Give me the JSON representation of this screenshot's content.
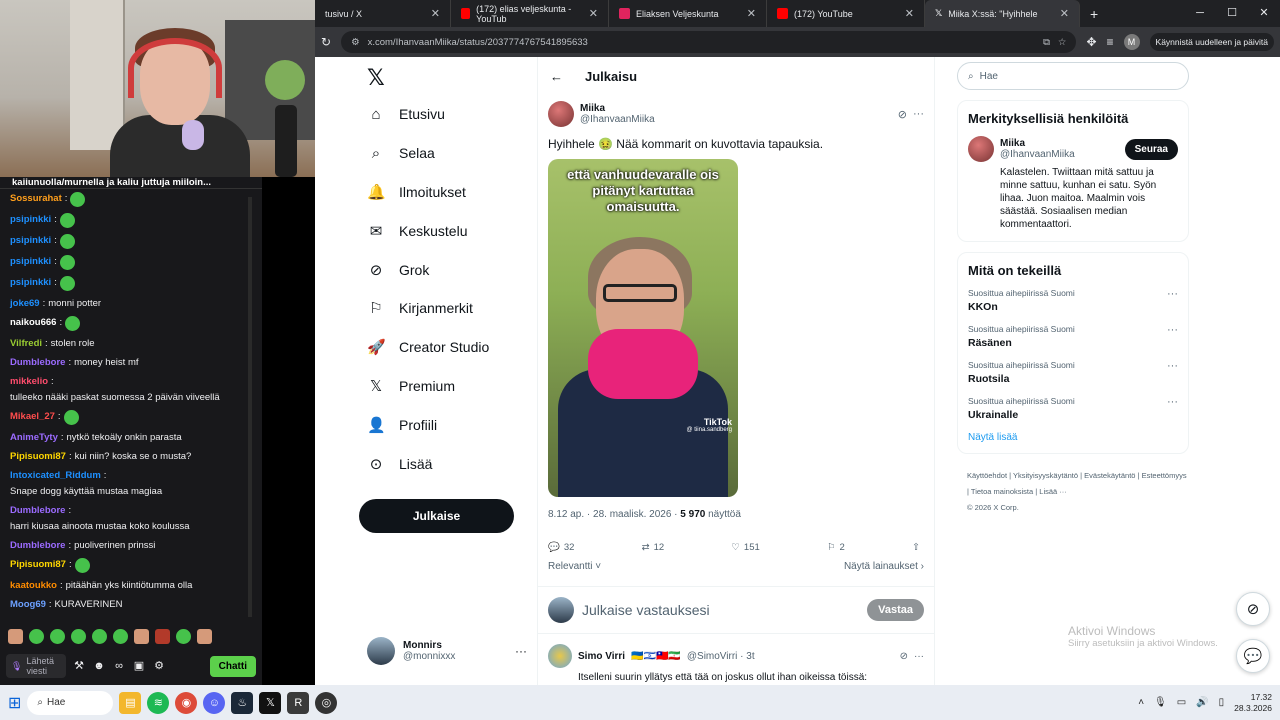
{
  "chat": {
    "pinned_text": "kaiiunuolla/murnella ja kaliu juttuja miiloin...",
    "messages": [
      {
        "user": "Sossurahat",
        "color": "#ff9f1c",
        "text": ""
      },
      {
        "user": "psipinkki",
        "color": "#1e90ff",
        "text": ""
      },
      {
        "user": "psipinkki",
        "color": "#1e90ff",
        "text": ""
      },
      {
        "user": "psipinkki",
        "color": "#1e90ff",
        "text": ""
      },
      {
        "user": "psipinkki",
        "color": "#1e90ff",
        "text": ""
      },
      {
        "user": "joke69",
        "color": "#1e90ff",
        "text": "monni potter"
      },
      {
        "user": "naikou666",
        "color": "#ffffff",
        "text": ""
      },
      {
        "user": "Vilfredi",
        "color": "#9acd32",
        "text": "stolen role"
      },
      {
        "user": "Dumblebore",
        "color": "#9b6bff",
        "text": "money heist mf"
      },
      {
        "user": "mikkelio",
        "color": "#ff4d6d",
        "text": "tulleeko nääki paskat suomessa 2 päivän viiveellä"
      },
      {
        "user": "Mikael_27",
        "color": "#ff4d4d",
        "text": ""
      },
      {
        "user": "AnimeTyty",
        "color": "#9b6bff",
        "text": "nytkö tekoäly onkin parasta"
      },
      {
        "user": "Pipisuomi87",
        "color": "#ffd700",
        "text": "kui niin? koska se o musta?"
      },
      {
        "user": "Intoxicated_Riddum",
        "color": "#1e90ff",
        "text": "Snape dogg käyttää mustaa magiaa"
      },
      {
        "user": "Dumblebore",
        "color": "#9b6bff",
        "text": "harri kiusaa ainoota mustaa koko koulussa"
      },
      {
        "user": "Dumblebore",
        "color": "#9b6bff",
        "text": "puoliverinen prinssi"
      },
      {
        "user": "Pipisuomi87",
        "color": "#ffd700",
        "text": ""
      },
      {
        "user": "kaatoukko",
        "color": "#ff8c00",
        "text": "pitäähän yks kiintiötumma olla"
      },
      {
        "user": "Moog69",
        "color": "#6ca0ff",
        "text": "KURAVERINEN"
      }
    ],
    "input_placeholder": "Lähetä viesti",
    "send_label": "Chatti"
  },
  "browser": {
    "tabs": [
      {
        "label": "tusivu / X",
        "favicon": "x"
      },
      {
        "label": "(172) elias veljeskunta - YouTub",
        "favicon": "yt"
      },
      {
        "label": "Eliaksen Veljeskunta",
        "favicon": "app"
      },
      {
        "label": "(172) YouTube",
        "favicon": "yt"
      },
      {
        "label": "Miika X:ssä: \"Hyihhele",
        "favicon": "x"
      }
    ],
    "url": "x.com/IhanvaanMiika/status/2037774767541895633",
    "restart_label": "Käynnistä uudelleen ja päivitä",
    "profile_letter": "M"
  },
  "nav": {
    "items": [
      {
        "label": "Etusivu",
        "icon": "home-icon"
      },
      {
        "label": "Selaa",
        "icon": "search-icon"
      },
      {
        "label": "Ilmoitukset",
        "icon": "bell-icon"
      },
      {
        "label": "Keskustelu",
        "icon": "mail-icon"
      },
      {
        "label": "Grok",
        "icon": "grok-icon"
      },
      {
        "label": "Kirjanmerkit",
        "icon": "bookmark-icon"
      },
      {
        "label": "Creator Studio",
        "icon": "rocket-icon"
      },
      {
        "label": "Premium",
        "icon": "x-icon"
      },
      {
        "label": "Profiili",
        "icon": "person-icon"
      },
      {
        "label": "Lisää",
        "icon": "more-icon"
      }
    ],
    "post_label": "Julkaise",
    "account": {
      "name": "Monnirs",
      "handle": "@monnixxx"
    }
  },
  "main": {
    "header_title": "Julkaisu",
    "tweet": {
      "name": "Miika",
      "handle": "@IhanvaanMiika",
      "text": "Hyihhele 🤢 Nää kommarit on kuvottavia tapauksia.",
      "media_caption": "että vanhuudevaralle ois pitänyt kartuttaa omaisuutta.",
      "media_watermark": "TikTok",
      "media_watermark_handle": "@ tiina.sandberg",
      "time": "8.12 ap. · 28. maalisk. 2026 · ",
      "views_count": "5 970",
      "views_label": " näyttöä",
      "replies": "32",
      "reposts": "12",
      "likes": "151",
      "bookmarks": "2",
      "sort_label": "Relevantti",
      "quotes_label": "Näytä lainaukset"
    },
    "reply_placeholder": "Julkaise vastauksesi",
    "reply_button": "Vastaa",
    "reply_tweet": {
      "name": "Simo Virri",
      "handle": "@SimoVirri · 3t",
      "text": "Itselleni suurin yllätys että tää on joskus ollut ihan oikeissa töissä:"
    }
  },
  "right": {
    "search_placeholder": "Hae",
    "relevant_title": "Merkityksellisiä henkilöitä",
    "relevant_person": {
      "name": "Miika",
      "handle": "@IhanvaanMiika",
      "follow": "Seuraa",
      "bio": "Kalastelen. Twiittaan mitä sattuu ja minne sattuu, kunhan ei satu. Syön lihaa. Juon maitoa. Maalmin vois säästää. Sosiaalisen median kommentaattori."
    },
    "trends_title": "Mitä on tekeillä",
    "trends": [
      {
        "context": "Suosittua aihepiirissä Suomi",
        "name": "KKOn"
      },
      {
        "context": "Suosittua aihepiirissä Suomi",
        "name": "Räsänen"
      },
      {
        "context": "Suosittua aihepiirissä Suomi",
        "name": "Ruotsila"
      },
      {
        "context": "Suosittua aihepiirissä Suomi",
        "name": "Ukrainalle"
      }
    ],
    "show_more": "Näytä lisää",
    "footer": [
      "Käyttöehdot",
      "Yksityisyyskäytäntö",
      "Evästekäytäntö",
      "Esteettömyys",
      "Tietoa mainoksista",
      "Lisää ···"
    ],
    "copyright": "© 2026 X Corp."
  },
  "activate_windows": {
    "title": "Aktivoi Windows",
    "sub": "Siirry asetuksiin ja aktivoi Windows."
  },
  "taskbar": {
    "search_label": "Hae",
    "time": "17.32",
    "date": "28.3.2026"
  }
}
